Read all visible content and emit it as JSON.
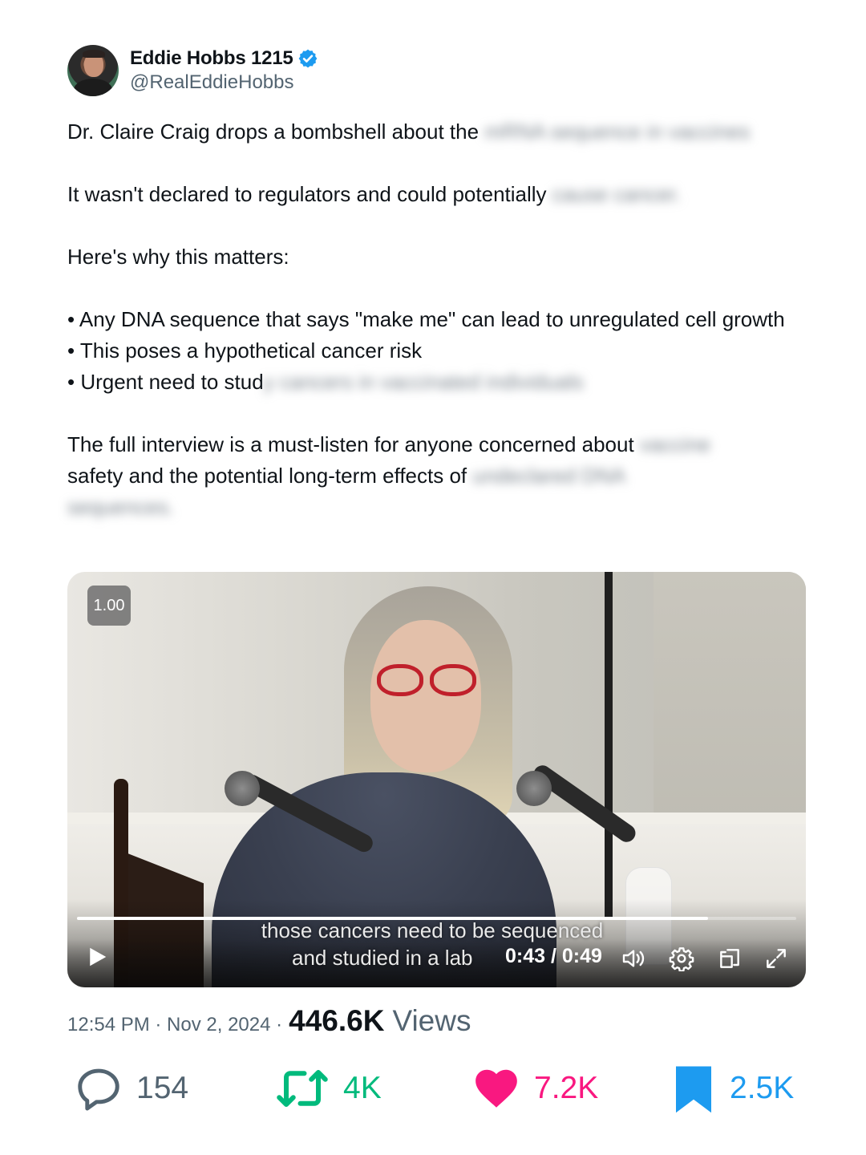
{
  "author": {
    "display_name": "Eddie Hobbs 1215",
    "handle": "@RealEddieHobbs",
    "verified": true
  },
  "tweet": {
    "line1_visible": "Dr. Claire Craig drops a bombshell about the",
    "line2_visible": "It wasn't declared to regulators and could potentially",
    "line3": "Here's why this matters:",
    "bullet1": "• Any DNA sequence that says \"make me\" can lead to unregulated cell growth",
    "bullet2": "• This poses a hypothetical cancer risk",
    "bullet3_visible": "• Urgent need to stud",
    "closing_visible_a": "The full interview is a must-listen for anyone concerned about",
    "closing_visible_b": "safety and the potential long-term effects of"
  },
  "video": {
    "speed_badge": "1.00",
    "caption_line1": "those cancers need to be sequenced",
    "caption_line2": "and studied in a lab",
    "time": "0:43 / 0:49",
    "progress": 0.877,
    "icons": [
      "play-icon",
      "volume-icon",
      "settings-icon",
      "picture-in-picture-icon",
      "fullscreen-icon"
    ]
  },
  "meta": {
    "timestamp": "12:54 PM · Nov 2, 2024 ·",
    "views_count": "446.6K",
    "views_label": "Views"
  },
  "actions": {
    "replies": "154",
    "retweets": "4K",
    "likes": "7.2K",
    "bookmarks": "2.5K"
  },
  "colors": {
    "text": "#0f1419",
    "secondary": "#536471",
    "verified": "#1d9bf0",
    "retweet": "#00ba7c",
    "like": "#f91880",
    "bookmark": "#1d9bf0"
  }
}
